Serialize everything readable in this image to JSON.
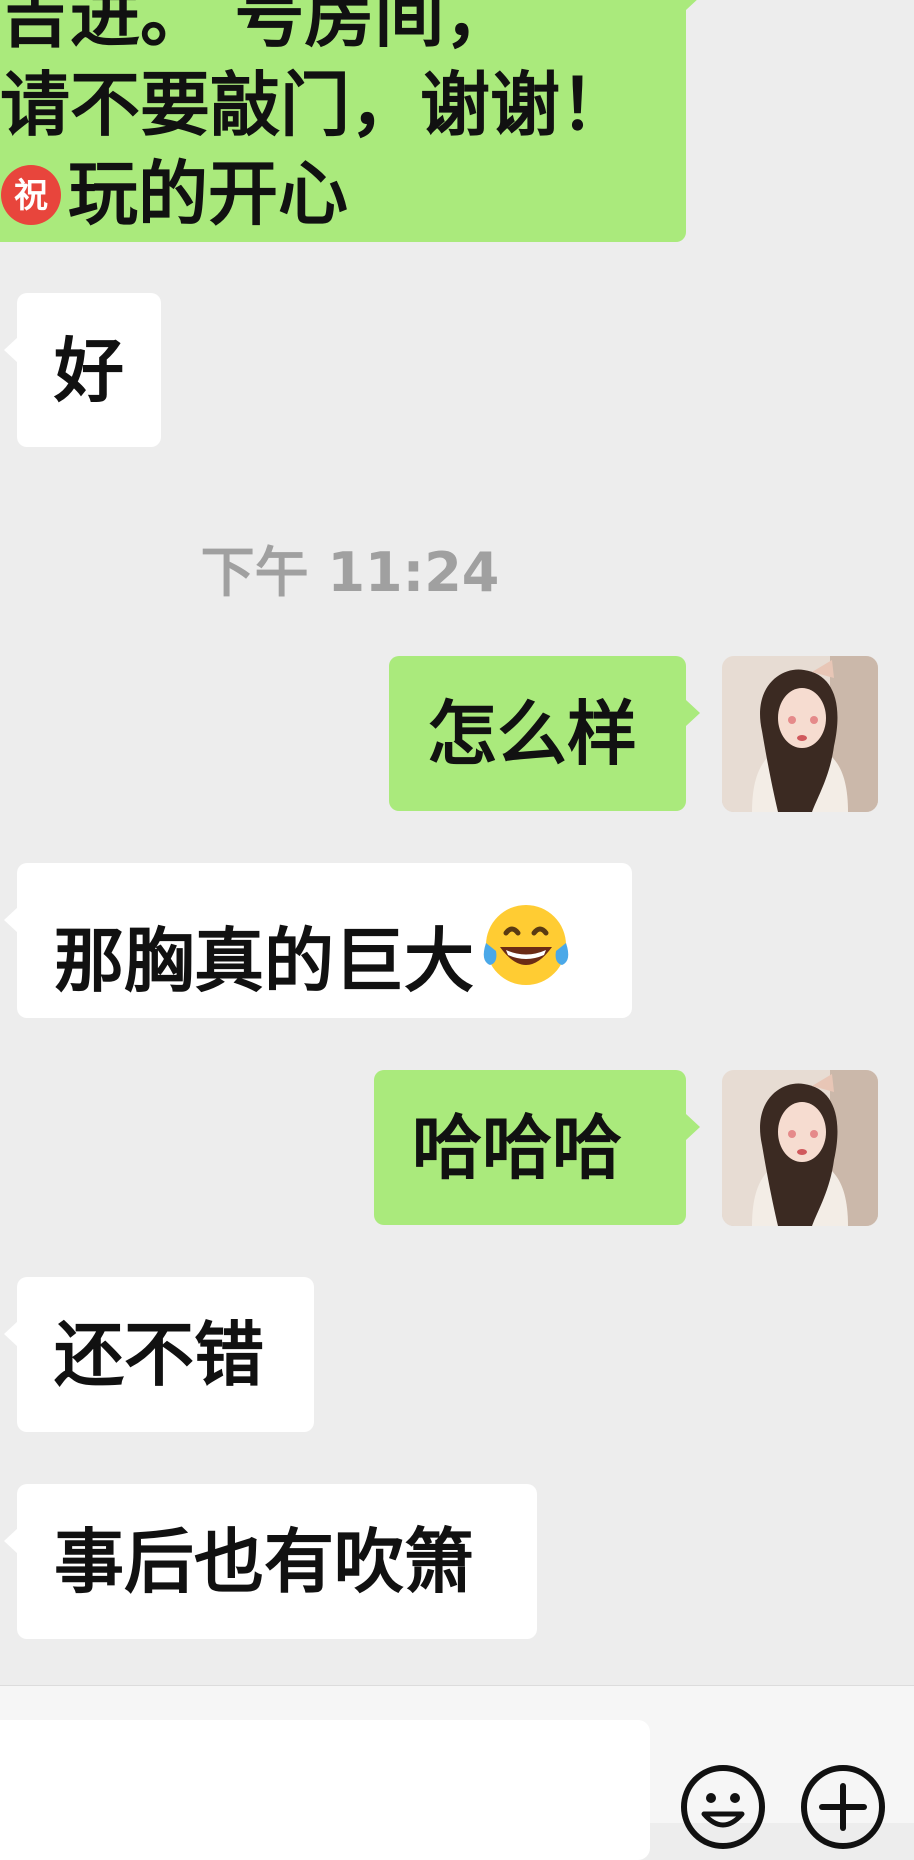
{
  "messages": {
    "top_out": {
      "line1": "吉进。        号房间，",
      "line2": "请不要敲门，谢谢！",
      "line3": "玩的开心",
      "badge_glyph": "祝"
    },
    "m1": "好",
    "time": "下午 11:24",
    "m2": "怎么样",
    "m3": "那胸真的巨大",
    "m4": "哈哈哈",
    "m5": "还不错",
    "m6": "事后也有吹箫"
  },
  "icons": {
    "laugh_emoji": "face-with-tears-of-joy",
    "congrats": "congratulations-circle",
    "emoji_button": "smiley-face-icon",
    "more_button": "plus-circle-icon"
  },
  "colors": {
    "background": "#ededed",
    "outgoing_bubble": "#aaea7c",
    "incoming_bubble": "#ffffff",
    "timestamp": "#a0a0a0"
  }
}
